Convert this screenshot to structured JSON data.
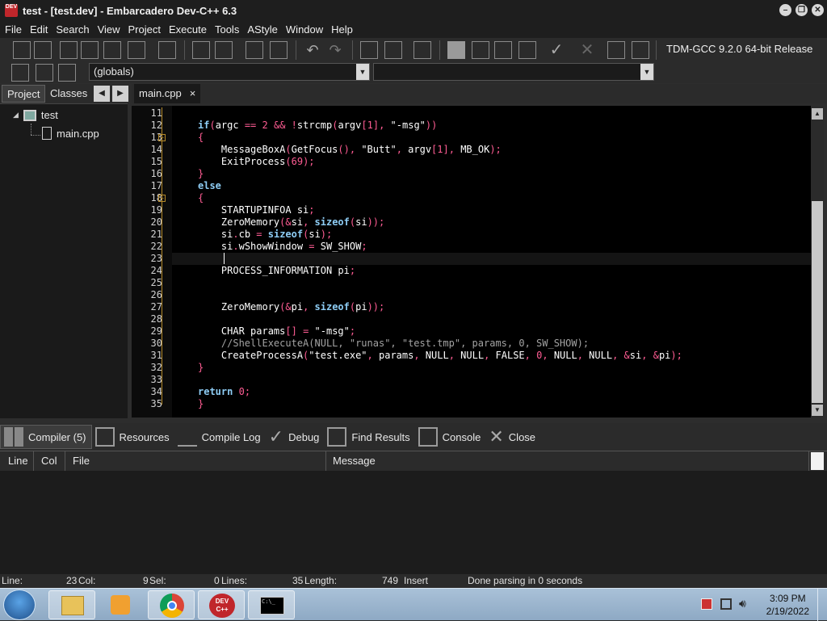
{
  "window": {
    "title": "test - [test.dev] - Embarcadero Dev-C++ 6.3",
    "app_icon_text": "DEV"
  },
  "menu": [
    "File",
    "Edit",
    "Search",
    "View",
    "Project",
    "Execute",
    "Tools",
    "AStyle",
    "Window",
    "Help"
  ],
  "toolbar": {
    "compiler_label": "TDM-GCC 9.2.0 64-bit Release",
    "scope_combo": "(globals)",
    "func_combo": ""
  },
  "left_panel": {
    "tabs": [
      "Project",
      "Classes"
    ],
    "tree": {
      "project": "test",
      "file": "main.cpp"
    }
  },
  "editor": {
    "tab_label": "main.cpp",
    "close_glyph": "×",
    "lines": [
      {
        "n": "11",
        "code": ""
      },
      {
        "n": "12",
        "code": "if(argc == 2 && !strcmp(argv[1], \"-msg\"))"
      },
      {
        "n": "13",
        "code": "{"
      },
      {
        "n": "14",
        "code": "    MessageBoxA(GetFocus(), \"Butt\", argv[1], MB_OK);"
      },
      {
        "n": "15",
        "code": "    ExitProcess(69);"
      },
      {
        "n": "16",
        "code": "}"
      },
      {
        "n": "17",
        "code": "else"
      },
      {
        "n": "18",
        "code": "{"
      },
      {
        "n": "19",
        "code": "    STARTUPINFOA si;"
      },
      {
        "n": "20",
        "code": "    ZeroMemory(&si, sizeof(si));"
      },
      {
        "n": "21",
        "code": "    si.cb = sizeof(si);"
      },
      {
        "n": "22",
        "code": "    si.wShowWindow = SW_SHOW;"
      },
      {
        "n": "23",
        "code": ""
      },
      {
        "n": "24",
        "code": "    PROCESS_INFORMATION pi;"
      },
      {
        "n": "25",
        "code": ""
      },
      {
        "n": "26",
        "code": ""
      },
      {
        "n": "27",
        "code": "    ZeroMemory(&pi, sizeof(pi));"
      },
      {
        "n": "28",
        "code": ""
      },
      {
        "n": "29",
        "code": "    CHAR params[] = \"-msg\";"
      },
      {
        "n": "30",
        "code": "    //ShellExecuteA(NULL, \"runas\", \"test.tmp\", params, 0, SW_SHOW);"
      },
      {
        "n": "31",
        "code": "    CreateProcessA(\"test.exe\", params, NULL, NULL, FALSE, 0, NULL, NULL, &si, &pi);"
      },
      {
        "n": "32",
        "code": "}"
      },
      {
        "n": "33",
        "code": ""
      },
      {
        "n": "34",
        "code": "return 0;"
      },
      {
        "n": "35",
        "code": "}"
      }
    ]
  },
  "bottom_panel": {
    "tabs": [
      "Compiler (5)",
      "Resources",
      "Compile Log",
      "Debug",
      "Find Results",
      "Console",
      "Close"
    ],
    "columns": [
      "Line",
      "Col",
      "File",
      "Message"
    ]
  },
  "status": {
    "line_label": "Line:",
    "line_value": "23",
    "col_label": "Col:",
    "col_value": "9",
    "sel_label": "Sel:",
    "sel_value": "0",
    "lines_label": "Lines:",
    "lines_value": "35",
    "length_label": "Length:",
    "length_value": "749",
    "mode": "Insert",
    "message": "Done parsing in 0 seconds"
  },
  "taskbar": {
    "time": "3:09 PM",
    "date": "2/19/2022",
    "devcpp_icon_text": "DEV C++",
    "console_icon_text": "C:\\_"
  },
  "colors": {
    "keyword": "#8ecdf5",
    "number_symbol": "#ff5c93",
    "comment": "#a3a3a3",
    "fold": "#b58a2a"
  }
}
